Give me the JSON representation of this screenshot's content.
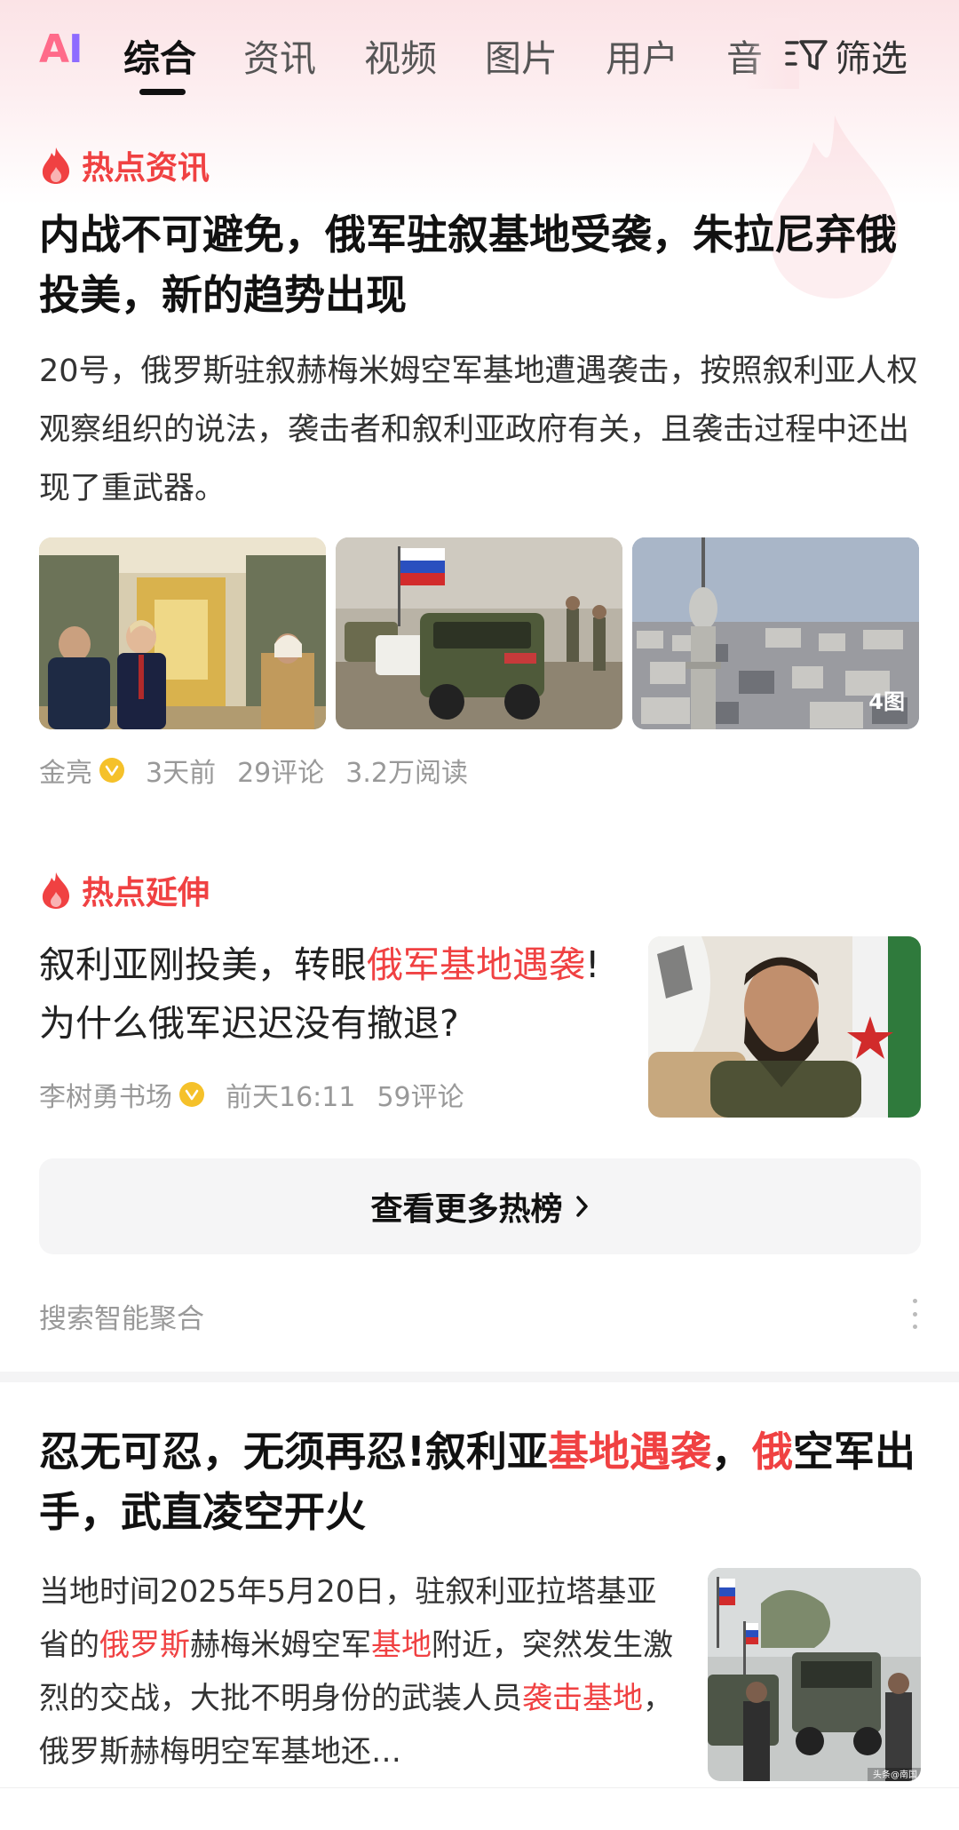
{
  "tabs": {
    "items": [
      "综合",
      "资讯",
      "视频",
      "图片",
      "用户",
      "音"
    ],
    "active_index": 0,
    "filter_label": "筛选"
  },
  "hot_news": {
    "section_label": "热点资讯",
    "title": "内战不可避免，俄军驻叙基地受袭，朱拉尼弃俄投美，新的趋势出现",
    "summary": "20号，俄罗斯驻叙赫梅米姆空军基地遭遇袭击，按照叙利亚人权观察组织的说法，袭击者和叙利亚政府有关，且袭击过程中还出现了重武器。",
    "image_count": "4图",
    "author": "金亮",
    "time": "3天前",
    "comments": "29评论",
    "reads": "3.2万阅读"
  },
  "hot_extend": {
    "section_label": "热点延伸",
    "title_before": "叙利亚刚投美，转眼",
    "title_highlight": "俄军基地遇袭",
    "title_after": "!为什么俄军迟迟没有撤退?",
    "author": "李树勇书场",
    "time": "前天16:11",
    "comments": "59评论"
  },
  "more_button": {
    "label": "查看更多热榜"
  },
  "aggregation_label": "搜索智能聚合",
  "article2": {
    "title_p1": "忍无可忍，无须再忍!叙利亚",
    "title_h1": "基地遇袭",
    "title_p2": "，",
    "title_h2": "俄",
    "title_p3": "空军出手，武直凌空开火",
    "body_p1": "当地时间2025年5月20日，驻叙利亚拉塔基亚省的",
    "body_h1": "俄罗斯",
    "body_p2": "赫梅米姆空军",
    "body_h2": "基地",
    "body_p3": "附近，突然发生激烈的交战，大批不明身份的武装人员",
    "body_h3": "袭击基地",
    "body_p4": "，俄罗斯赫梅明空军基地还…",
    "image_watermark": "头条@南国"
  },
  "colors": {
    "accent_red": "#f04142",
    "verified_badge": "#f5c12a",
    "meta_gray": "#999999"
  }
}
